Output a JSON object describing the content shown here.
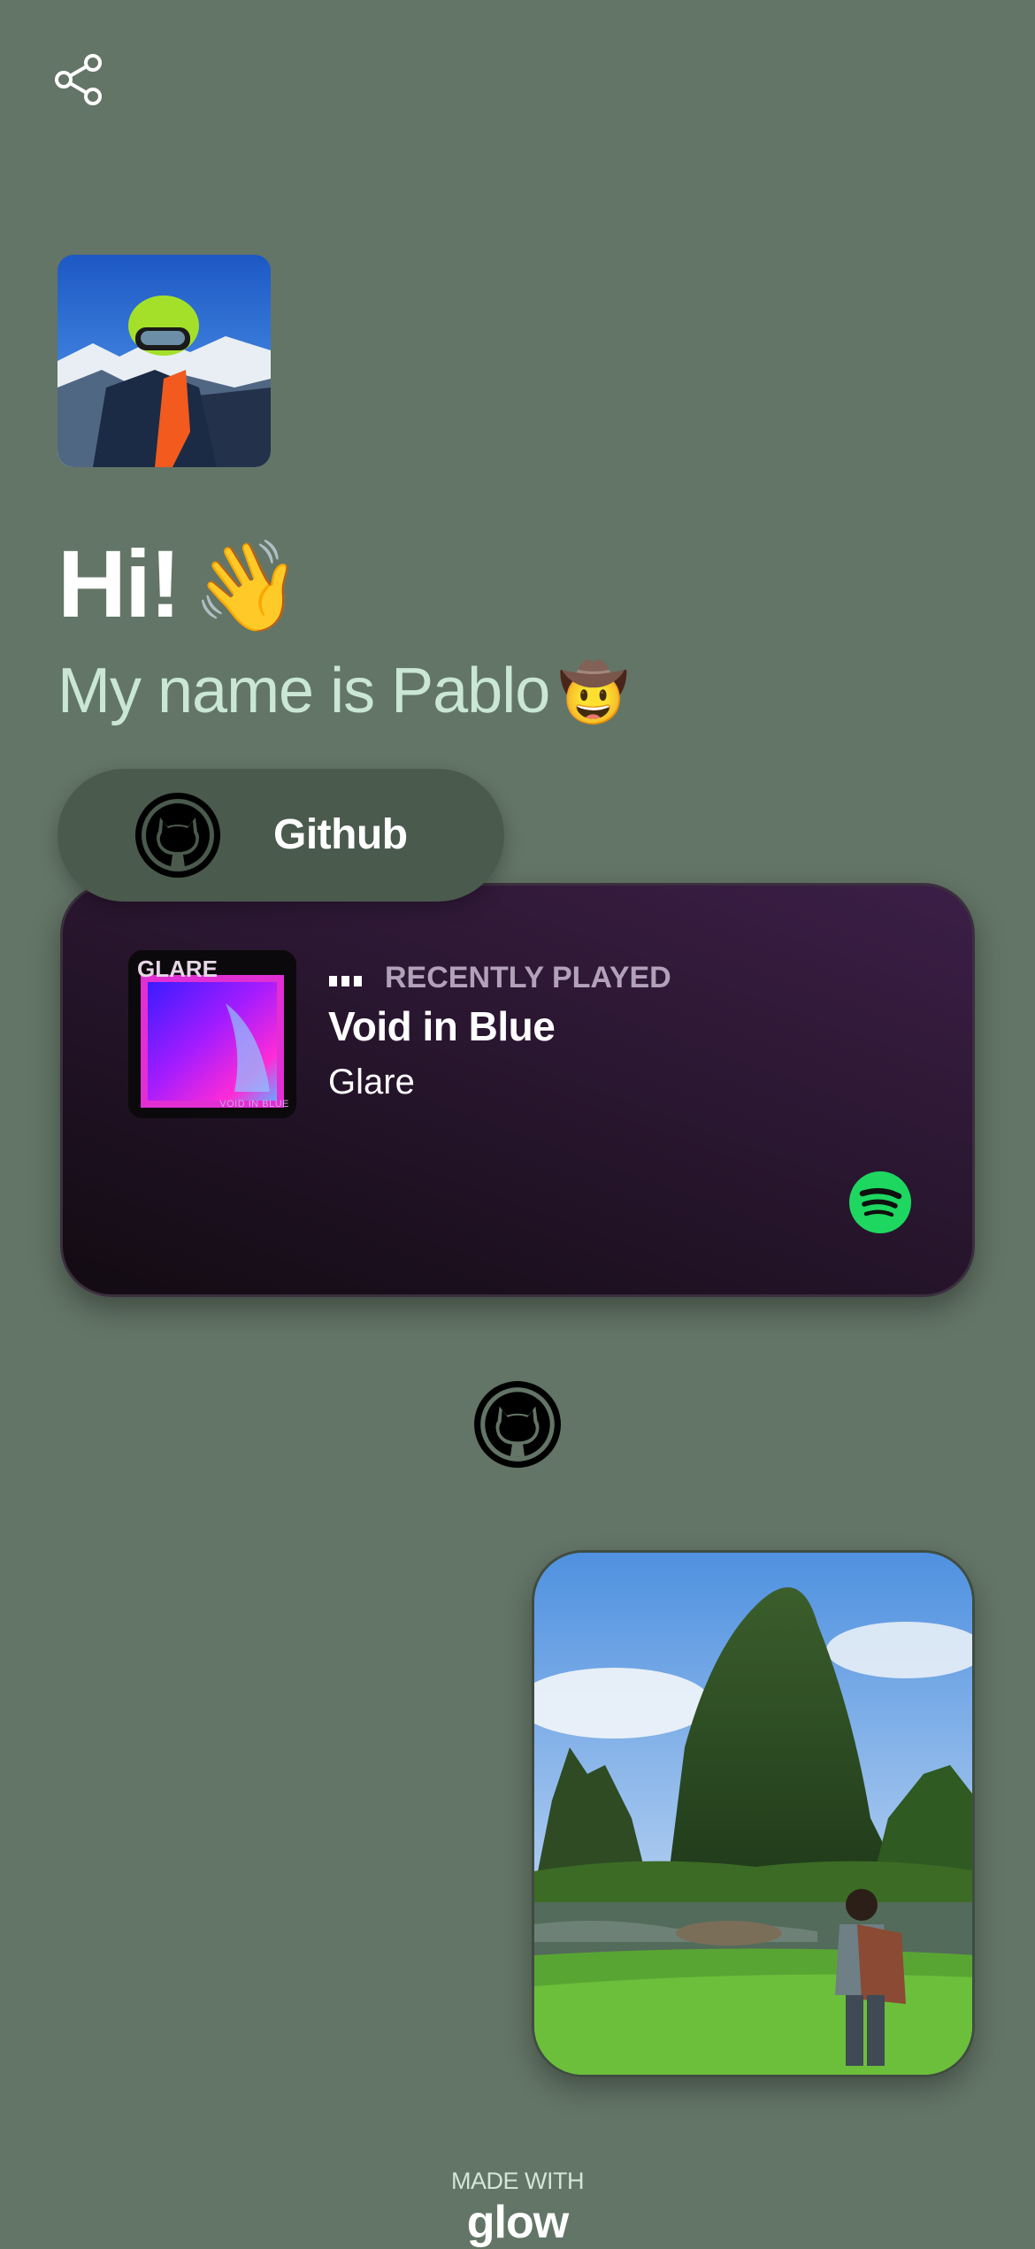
{
  "header": {
    "share_icon": "share-icon"
  },
  "profile": {
    "avatar_icon": "avatar-photo",
    "greeting": "Hi!",
    "greeting_emoji": "👋",
    "subtitle": "My name is Pablo",
    "subtitle_emoji": "🤠"
  },
  "links": {
    "github_label": "Github",
    "github_icon": "github-icon"
  },
  "spotify": {
    "album_title": "GLARE",
    "album_subtitle": "VOID IN BLUE",
    "status_label": "RECENTLY PLAYED",
    "track_title": "Void in Blue",
    "artist": "Glare",
    "icon": "spotify-icon",
    "brand_color": "#1ed760"
  },
  "footer": {
    "made_with": "MADE WITH",
    "brand": "glow"
  },
  "colors": {
    "background": "#637566",
    "pill": "#4a5a4d",
    "subtitle": "#c9e7d3"
  }
}
